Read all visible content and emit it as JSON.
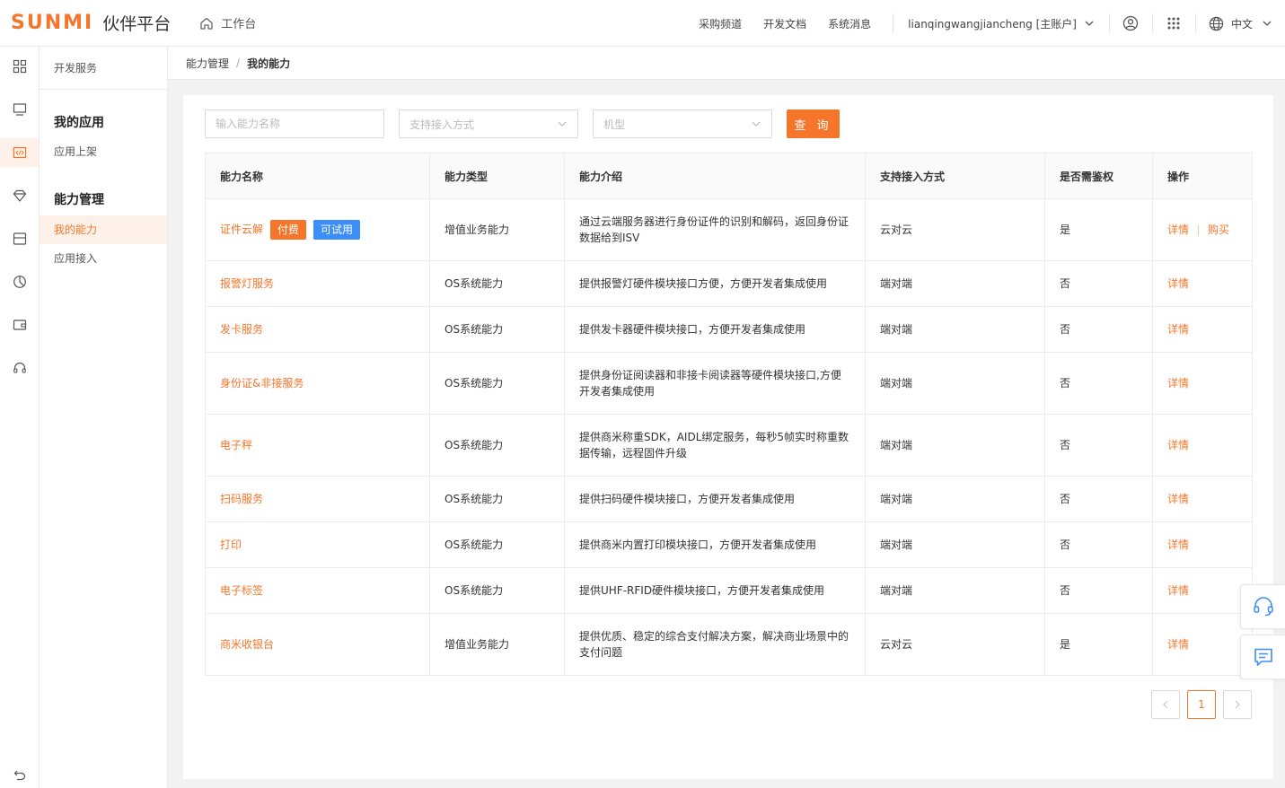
{
  "brand": {
    "logo": "SUNMI",
    "title": "伙伴平台"
  },
  "header": {
    "home": "工作台",
    "nav": [
      "采购频道",
      "开发文档",
      "系统消息"
    ],
    "account": "lianqingwangjiancheng [主账户]",
    "lang": "中文"
  },
  "sidebar": {
    "head": "开发服务",
    "groups": [
      {
        "title": "我的应用",
        "items": [
          "应用上架"
        ]
      },
      {
        "title": "能力管理",
        "items": [
          "我的能力",
          "应用接入"
        ]
      }
    ]
  },
  "breadcrumb": [
    "能力管理",
    "我的能力"
  ],
  "filters": {
    "name_placeholder": "输入能力名称",
    "access_placeholder": "支持接入方式",
    "model_placeholder": "机型",
    "query": "查 询"
  },
  "table": {
    "columns": [
      "能力名称",
      "能力类型",
      "能力介绍",
      "支持接入方式",
      "是否需鉴权",
      "操作"
    ],
    "rows": [
      {
        "name": "证件云解",
        "tags": [
          "付费",
          "可试用"
        ],
        "type": "增值业务能力",
        "desc": "通过云端服务器进行身份证件的识别和解码，返回身份证数据给到ISV",
        "access": "云对云",
        "auth": "是",
        "ops": [
          "详情",
          "购买"
        ]
      },
      {
        "name": "报警灯服务",
        "tags": [],
        "type": "OS系统能力",
        "desc": "提供报警灯硬件模块接口方便，方便开发者集成使用",
        "access": "端对端",
        "auth": "否",
        "ops": [
          "详情"
        ]
      },
      {
        "name": "发卡服务",
        "tags": [],
        "type": "OS系统能力",
        "desc": "提供发卡器硬件模块接口，方便开发者集成使用",
        "access": "端对端",
        "auth": "否",
        "ops": [
          "详情"
        ]
      },
      {
        "name": "身份证&非接服务",
        "tags": [],
        "type": "OS系统能力",
        "desc": "提供身份证阅读器和非接卡阅读器等硬件模块接口,方便开发者集成使用",
        "access": "端对端",
        "auth": "否",
        "ops": [
          "详情"
        ]
      },
      {
        "name": "电子秤",
        "tags": [],
        "type": "OS系统能力",
        "desc": "提供商米称重SDK，AIDL绑定服务，每秒5帧实时称重数据传输，远程固件升级",
        "access": "端对端",
        "auth": "否",
        "ops": [
          "详情"
        ]
      },
      {
        "name": "扫码服务",
        "tags": [],
        "type": "OS系统能力",
        "desc": "提供扫码硬件模块接口，方便开发者集成使用",
        "access": "端对端",
        "auth": "否",
        "ops": [
          "详情"
        ]
      },
      {
        "name": "打印",
        "tags": [],
        "type": "OS系统能力",
        "desc": "提供商米内置打印模块接口，方便开发者集成使用",
        "access": "端对端",
        "auth": "否",
        "ops": [
          "详情"
        ]
      },
      {
        "name": "电子标签",
        "tags": [],
        "type": "OS系统能力",
        "desc": "提供UHF-RFID硬件模块接口，方便开发者集成使用",
        "access": "端对端",
        "auth": "否",
        "ops": [
          "详情"
        ]
      },
      {
        "name": "商米收银台",
        "tags": [],
        "type": "增值业务能力",
        "desc": "提供优质、稳定的综合支付解决方案，解决商业场景中的支付问题",
        "access": "云对云",
        "auth": "是",
        "ops": [
          "详情"
        ]
      }
    ]
  },
  "pagination": {
    "current": "1"
  },
  "colors": {
    "accent": "#f5762a",
    "tag_blue": "#3d8ef7"
  },
  "icons": [
    "home-icon",
    "chevron-down-icon",
    "user-icon",
    "apps-grid-icon",
    "globe-icon",
    "dashboard-icon",
    "monitor-icon",
    "code-icon",
    "diamond-icon",
    "store-icon",
    "pie-chart-icon",
    "wallet-icon",
    "headset-icon",
    "collapse-icon",
    "message-icon"
  ]
}
